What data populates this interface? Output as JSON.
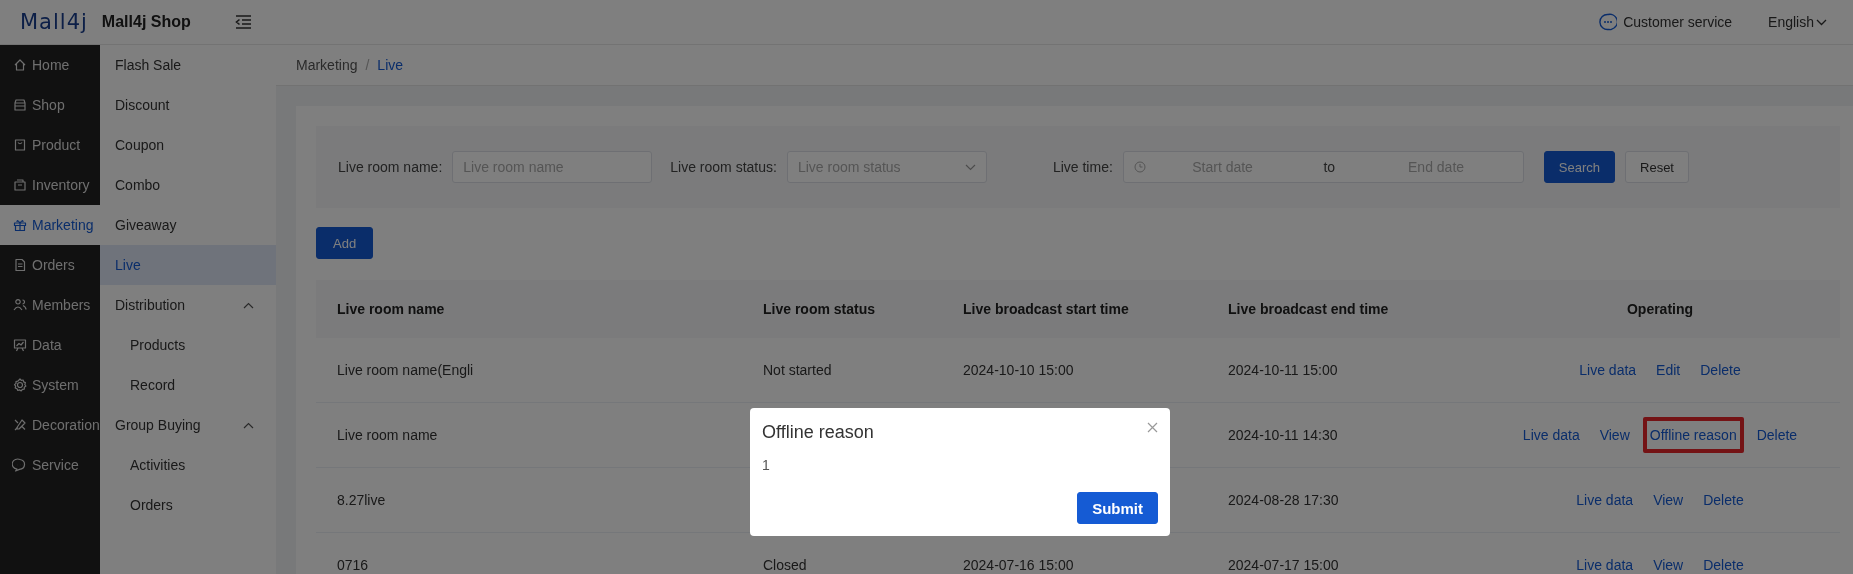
{
  "header": {
    "logo": "Mall4j",
    "shop_name": "Mall4j Shop",
    "customer_service": "Customer service",
    "language": "English"
  },
  "main_menu": [
    {
      "label": "Home",
      "selected": false
    },
    {
      "label": "Shop",
      "selected": false
    },
    {
      "label": "Product",
      "selected": false
    },
    {
      "label": "Inventory",
      "selected": false
    },
    {
      "label": "Marketing",
      "selected": true
    },
    {
      "label": "Orders",
      "selected": false
    },
    {
      "label": "Members",
      "selected": false
    },
    {
      "label": "Data",
      "selected": false
    },
    {
      "label": "System",
      "selected": false
    },
    {
      "label": "Decoration",
      "selected": false
    },
    {
      "label": "Service",
      "selected": false
    }
  ],
  "sub_menu": [
    {
      "label": "Flash Sale",
      "selected": false
    },
    {
      "label": "Discount",
      "selected": false
    },
    {
      "label": "Coupon",
      "selected": false
    },
    {
      "label": "Combo",
      "selected": false
    },
    {
      "label": "Giveaway",
      "selected": false
    },
    {
      "label": "Live",
      "selected": true
    },
    {
      "label": "Distribution",
      "selected": false,
      "expanded": true,
      "children": [
        {
          "label": "Products",
          "selected": false
        },
        {
          "label": "Record",
          "selected": false
        }
      ]
    },
    {
      "label": "Group Buying",
      "selected": false,
      "expanded": true,
      "children": [
        {
          "label": "Activities",
          "selected": false
        },
        {
          "label": "Orders",
          "selected": false
        }
      ]
    }
  ],
  "breadcrumb_separator": "/",
  "breadcrumb": [
    {
      "label": "Marketing",
      "selected": false
    },
    {
      "label": "Live",
      "selected": true
    }
  ],
  "filters": {
    "name_label": "Live room name:",
    "name_placeholder": "Live room name",
    "status_label": "Live room status:",
    "status_placeholder": "Live room status",
    "time_label": "Live time:",
    "start_placeholder": "Start date",
    "range_separator": "to",
    "end_placeholder": "End date",
    "search_button": "Search",
    "reset_button": "Reset"
  },
  "add_button": "Add",
  "table": {
    "columns": [
      "Live room name",
      "Live room status",
      "Live broadcast start time",
      "Live broadcast end time",
      "Operating"
    ],
    "rows": [
      {
        "name": "Live room name(Engli",
        "status": "Not started",
        "start_time": "2024-10-10 15:00",
        "end_time": "2024-10-11 15:00",
        "actions": [
          {
            "label": "Live data",
            "highlighted": false
          },
          {
            "label": "Edit",
            "highlighted": false
          },
          {
            "label": "Delete",
            "highlighted": false
          }
        ]
      },
      {
        "name": "Live room name",
        "end_time": "2024-10-11 14:30",
        "actions": [
          {
            "label": "Live data",
            "highlighted": false
          },
          {
            "label": "View",
            "highlighted": false
          },
          {
            "label": "Offline reason",
            "highlighted": true
          },
          {
            "label": "Delete",
            "highlighted": false
          }
        ]
      },
      {
        "name": "8.27live",
        "end_time": "2024-08-28 17:30",
        "actions": [
          {
            "label": "Live data",
            "highlighted": false
          },
          {
            "label": "View",
            "highlighted": false
          },
          {
            "label": "Delete",
            "highlighted": false
          }
        ]
      },
      {
        "name": "0716",
        "status": "Closed",
        "start_time": "2024-07-16 15:00",
        "end_time": "2024-07-17 15:00",
        "actions": [
          {
            "label": "Live data",
            "highlighted": false
          },
          {
            "label": "View",
            "highlighted": false
          },
          {
            "label": "Delete",
            "highlighted": false
          }
        ]
      }
    ]
  },
  "modal": {
    "title": "Offline reason",
    "body": "1",
    "submit_button": "Submit"
  }
}
